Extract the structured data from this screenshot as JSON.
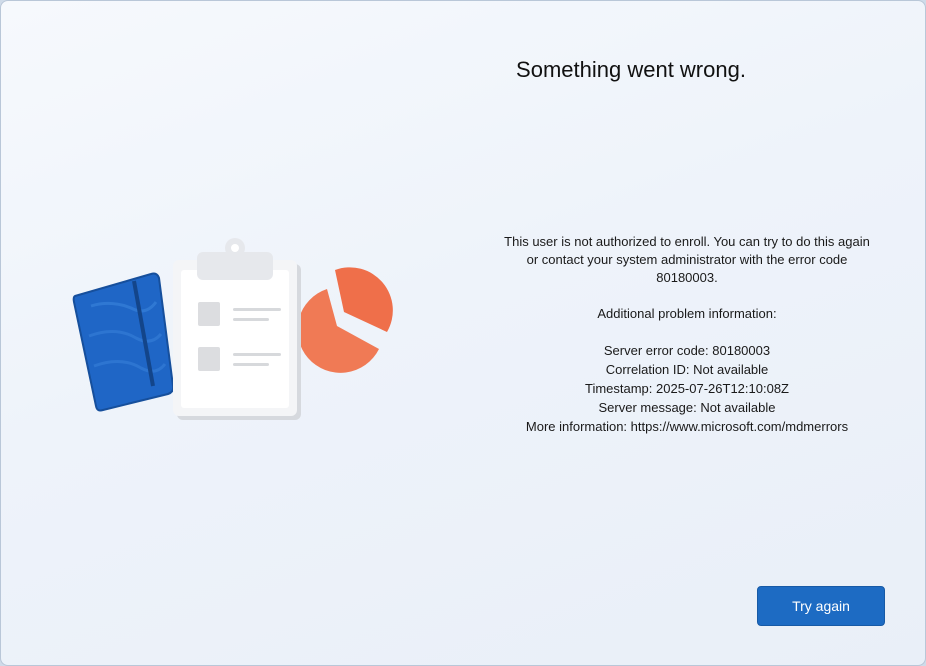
{
  "header": {
    "title": "Something went wrong."
  },
  "message": {
    "body": "This user is not authorized to enroll. You can try to do this again or contact your system administrator with the error code 80180003.",
    "additional_title": "Additional problem information:",
    "details": [
      {
        "label": "Server error code",
        "value": "80180003",
        "text": "Server error code: 80180003"
      },
      {
        "label": "Correlation ID",
        "value": "Not available",
        "text": "Correlation ID: Not available"
      },
      {
        "label": "Timestamp",
        "value": "2025-07-26T12:10:08Z",
        "text": "Timestamp: 2025-07-26T12:10:08Z"
      },
      {
        "label": "Server message",
        "value": "Not available",
        "text": "Server message: Not available"
      },
      {
        "label": "More information",
        "value": "https://www.microsoft.com/mdmerrors",
        "text": "More information: https://www.microsoft.com/mdmerrors"
      }
    ]
  },
  "actions": {
    "try_again_label": "Try again"
  },
  "illustration": {
    "icons": [
      "notebook-icon",
      "clipboard-icon",
      "pie-chart-icon"
    ]
  },
  "colors": {
    "accent": "#1d6bc3",
    "notebook": "#1f66c6",
    "pie": "#f07a55"
  }
}
